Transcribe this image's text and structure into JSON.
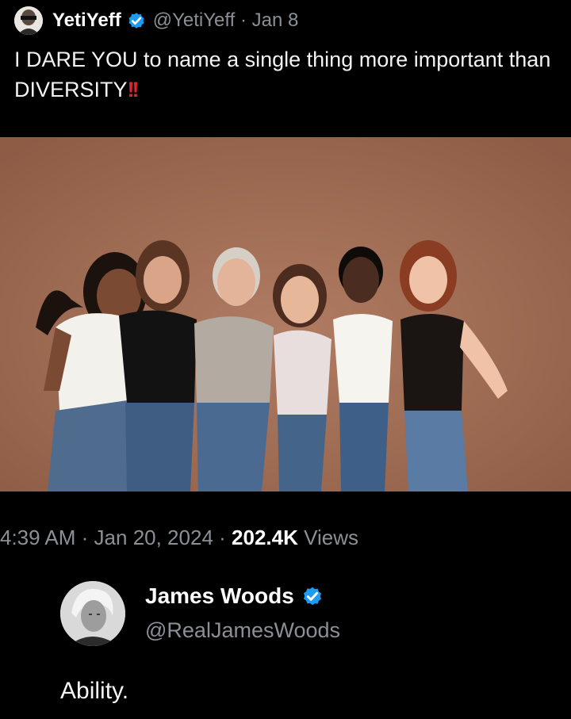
{
  "tweet": {
    "author_name": "YetiYeff",
    "author_handle": "@YetiYeff",
    "separator": "·",
    "date": "Jan 8",
    "text": "I DARE YOU to name a single thing more important than DIVERSITY",
    "emphasis": "!!",
    "photo_alt": "Six women in tank tops and jeans posing together against a brown backdrop",
    "time": "4:39 AM",
    "full_date": "Jan 20, 2024",
    "views_count": "202.4K",
    "views_label": "Views"
  },
  "reply": {
    "author_name": "James Woods",
    "author_handle": "@RealJamesWoods",
    "text": "Ability."
  },
  "colors": {
    "background": "#000000",
    "verified_badge": "#1d9bf0",
    "muted_text": "#8b9096",
    "emphasis_red": "#e0262b"
  },
  "icons": {
    "verified": "verified-badge-icon"
  }
}
